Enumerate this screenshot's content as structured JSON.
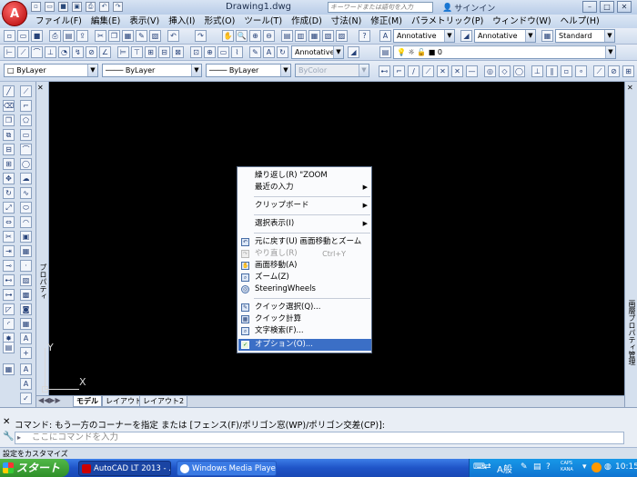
{
  "app": {
    "document_title": "Drawing1.dwg",
    "search_placeholder": "キーワードまたは語句を入力",
    "signin_label": "サインイン"
  },
  "menubar": {
    "items": [
      "ファイル(F)",
      "編集(E)",
      "表示(V)",
      "挿入(I)",
      "形式(O)",
      "ツール(T)",
      "作成(D)",
      "寸法(N)",
      "修正(M)",
      "パラメトリック(P)",
      "ウィンドウ(W)",
      "ヘルプ(H)"
    ]
  },
  "toolbar": {
    "annotative1": "Annotative",
    "annotative2": "Annotative",
    "style_standard": "Standard",
    "annotative3": "Annotative",
    "layer_value": "0",
    "bylayer1": "ByLayer",
    "bylayer2": "ByLayer",
    "bylayer3": "ByLayer",
    "bycolor": "ByColor"
  },
  "palettes": {
    "left_title": "プロパティ",
    "right_title": "画層プロパティ管理"
  },
  "tabs": {
    "model": "モデル",
    "layout1": "レイアウト1",
    "layout2": "レイアウト2"
  },
  "context_menu": {
    "items": [
      {
        "label": "繰り返し(R) \"ZOOM",
        "submenu": false
      },
      {
        "label": "最近の入力",
        "submenu": true
      },
      {
        "label": "クリップボード",
        "submenu": true
      },
      {
        "label": "選択表示(I)",
        "submenu": true
      },
      {
        "label": "元に戻す(U) 画面移動とズーム",
        "submenu": false
      },
      {
        "label": "やり直し(R)",
        "shortcut": "Ctrl+Y",
        "disabled": true
      },
      {
        "label": "画面移動(A)",
        "submenu": false
      },
      {
        "label": "ズーム(Z)",
        "submenu": false
      },
      {
        "label": "SteeringWheels",
        "submenu": false
      },
      {
        "label": "クイック選択(Q)...",
        "submenu": false
      },
      {
        "label": "クイック計算",
        "submenu": false
      },
      {
        "label": "文字検索(F)...",
        "submenu": false
      },
      {
        "label": "オプション(O)...",
        "submenu": false,
        "highlighted": true
      }
    ]
  },
  "ucs": {
    "x_label": "X",
    "y_label": "Y"
  },
  "command": {
    "history": "コマンド: もう一方のコーナーを指定 または [フェンス(F)/ポリゴン窓(WP)/ポリゴン交差(CP)]:",
    "input_placeholder": "ここにコマンドを入力"
  },
  "statusbar": {
    "text": "設定をカスタマイズ"
  },
  "taskbar": {
    "start": "スタート",
    "task1": "AutoCAD LT 2013 - ...",
    "task2": "Windows Media Player",
    "ime": "A般",
    "caps": "CAPS",
    "kana": "KANA",
    "clock": "10:15"
  },
  "colors": {
    "highlight": "#3b6fc6",
    "canvas": "#000000",
    "taskbar": "#1f54c7",
    "start": "#2e8f29"
  }
}
